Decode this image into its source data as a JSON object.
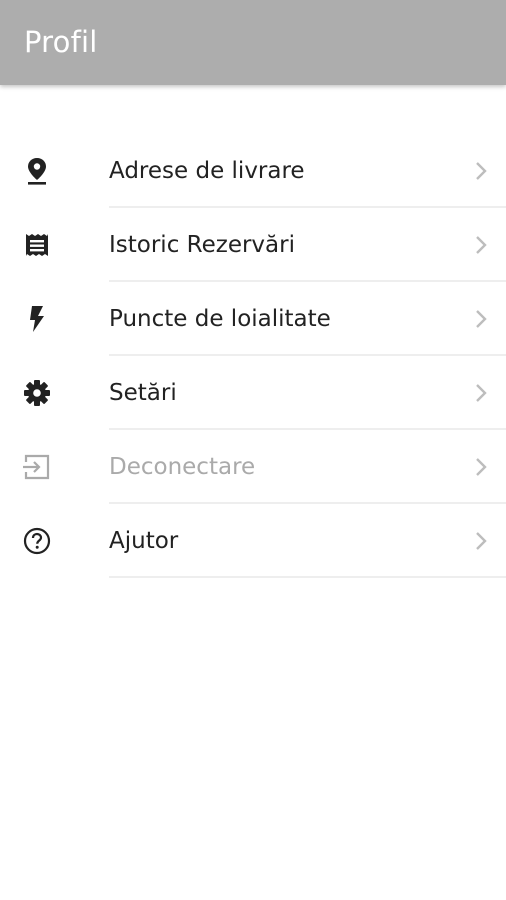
{
  "app_bar": {
    "title": "Profil",
    "background": "#adadad"
  },
  "menu": {
    "items": [
      {
        "label": "Adrese de livrare",
        "icon": "location-pin-icon",
        "enabled": true
      },
      {
        "label": "Istoric Rezervări",
        "icon": "receipt-list-icon",
        "enabled": true
      },
      {
        "label": "Puncte de loialitate",
        "icon": "lightning-bolt-icon",
        "enabled": true
      },
      {
        "label": "Setări",
        "icon": "gear-icon",
        "enabled": true
      },
      {
        "label": "Deconectare",
        "icon": "exit-icon",
        "enabled": false
      },
      {
        "label": "Ajutor",
        "icon": "help-circle-icon",
        "enabled": true
      }
    ],
    "colors": {
      "text": "#222222",
      "disabled_text": "#aaaaaa",
      "chevron": "#bdbdbd",
      "divider": "#eeeeee"
    }
  }
}
